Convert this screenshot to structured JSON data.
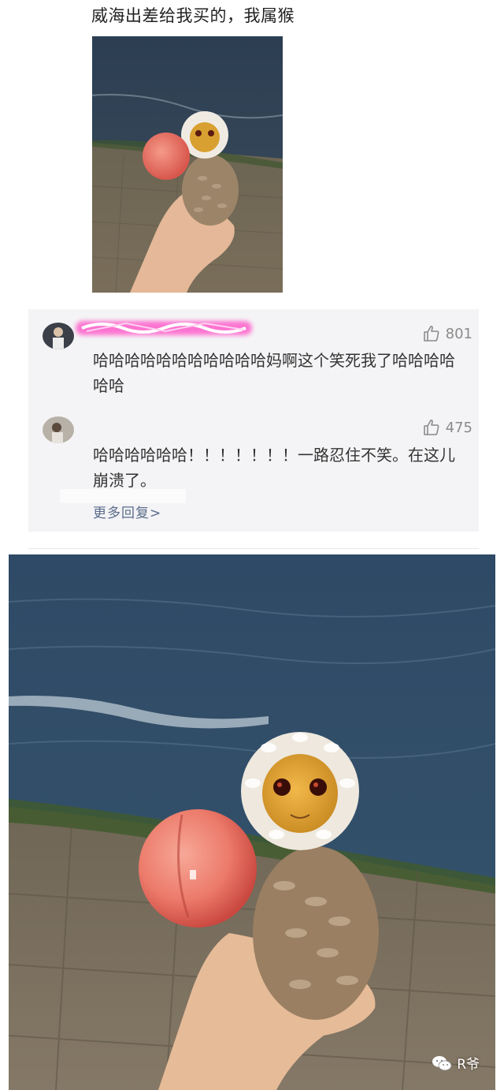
{
  "post": {
    "caption": "威海出差给我买的，我属猴"
  },
  "comments": [
    {
      "likes": "801",
      "text": "哈哈哈哈哈哈哈哈哈哈哈妈啊这个笑死我了哈哈哈哈哈哈"
    },
    {
      "likes": "475",
      "text": "哈哈哈哈哈哈！！！！！！！一路忍住不笑。在这儿崩溃了。"
    }
  ],
  "more_replies": "更多回复>",
  "watermark": {
    "text": "R爷",
    "icon": "wechat-icon"
  },
  "colors": {
    "panel": "#f4f4f6",
    "link": "#5a6b8a",
    "meta": "#8a8a8a"
  }
}
